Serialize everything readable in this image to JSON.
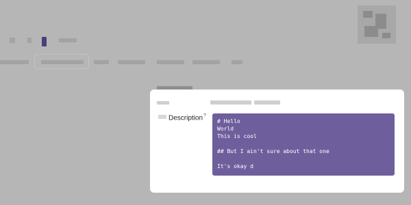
{
  "description_field": {
    "label": "Description",
    "help_marker": "?",
    "editor_lines": [
      "# Hello",
      "World",
      "This is cool",
      "",
      "## But I ain't sure about that one",
      "",
      "It's okay d"
    ]
  },
  "colors": {
    "editor_background": "#6e5f9c",
    "editor_text": "#ffffff",
    "card_background": "#ffffff",
    "page_overlay": "#b6b6b6"
  },
  "icons": {
    "help": "question-mark-icon"
  }
}
